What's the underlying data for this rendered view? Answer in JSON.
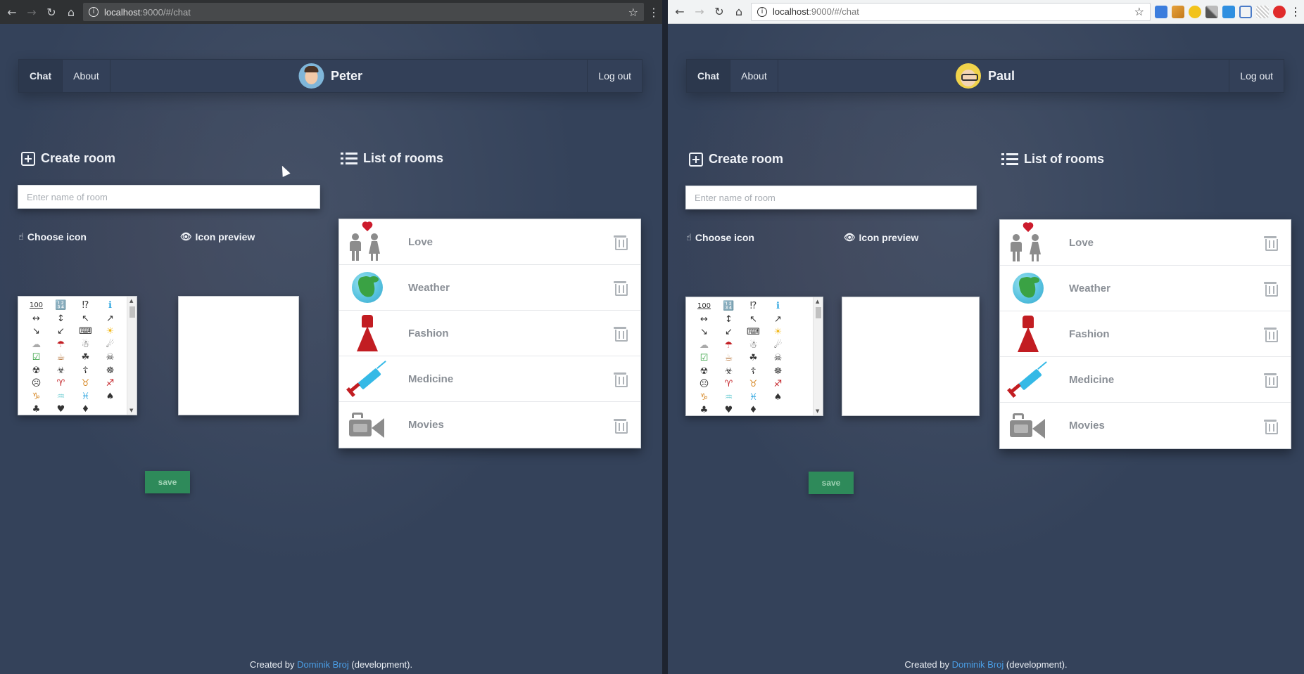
{
  "windows": [
    {
      "id": "peter",
      "browser": {
        "url_host": "localhost",
        "url_rest": ":9000/#/chat"
      },
      "nav": {
        "chat": "Chat",
        "about": "About",
        "user": "Peter",
        "logout": "Log out"
      },
      "create_room": {
        "title": "Create room",
        "placeholder": "Enter name of room",
        "choose_icon": "Choose icon",
        "icon_preview": "Icon preview",
        "save": "save"
      },
      "rooms_title": "List of rooms",
      "rooms": [
        {
          "name": "Love",
          "icon": "couple-heart-icon"
        },
        {
          "name": "Weather",
          "icon": "globe-icon"
        },
        {
          "name": "Fashion",
          "icon": "dress-icon"
        },
        {
          "name": "Medicine",
          "icon": "syringe-icon"
        },
        {
          "name": "Movies",
          "icon": "movie-camera-icon"
        }
      ],
      "footer": {
        "prefix": "Created by ",
        "author": "Dominik Broj",
        "suffix": " (development)."
      }
    },
    {
      "id": "paul",
      "browser": {
        "url_host": "localhost",
        "url_rest": ":9000/#/chat"
      },
      "nav": {
        "chat": "Chat",
        "about": "About",
        "user": "Paul",
        "logout": "Log out"
      },
      "create_room": {
        "title": "Create room",
        "placeholder": "Enter name of room",
        "choose_icon": "Choose icon",
        "icon_preview": "Icon preview",
        "save": "save"
      },
      "rooms_title": "List of rooms",
      "rooms": [
        {
          "name": "Love",
          "icon": "couple-heart-icon"
        },
        {
          "name": "Weather",
          "icon": "globe-icon"
        },
        {
          "name": "Fashion",
          "icon": "dress-icon"
        },
        {
          "name": "Medicine",
          "icon": "syringe-icon"
        },
        {
          "name": "Movies",
          "icon": "movie-camera-icon"
        }
      ],
      "footer": {
        "prefix": "Created by ",
        "author": "Dominik Broj",
        "suffix": " (development)."
      }
    }
  ],
  "icon_choices": [
    "100",
    "🔢",
    "⁉",
    "ℹ",
    "↔",
    "↕",
    "↖",
    "↗",
    "↘",
    "↙",
    "⌨",
    "☀",
    "☁",
    "☂",
    "☃",
    "☄",
    "☑",
    "☕",
    "☘",
    "☠",
    "☢",
    "☣",
    "☦",
    "☸",
    "☹",
    "♈",
    "♉",
    "♐",
    "♑",
    "♒",
    "♓",
    "♠",
    "♣",
    "♥",
    "♦"
  ],
  "colors": {
    "page_bg": "#34425a",
    "save_button": "#2e8a5a",
    "link": "#4a9ee6"
  }
}
